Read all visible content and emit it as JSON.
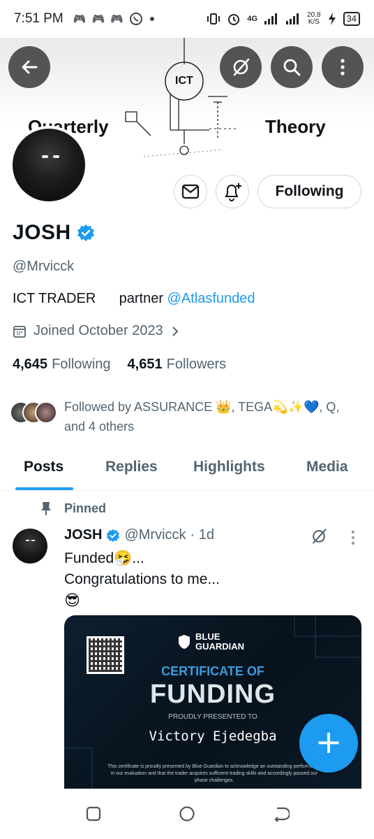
{
  "status_bar": {
    "time": "7:51 PM",
    "network": "4G",
    "speed_value": "20.8",
    "speed_unit": "K/S",
    "battery": "34"
  },
  "banner": {
    "logo_text": "ICT",
    "word_left": "Quarterly",
    "word_right": "Theory"
  },
  "profile": {
    "name": "JOSH",
    "handle": "@Mrvicck",
    "bio_text": "ICT TRADER      partner ",
    "bio_mention": "@Atlasfunded",
    "joined": "Joined October 2023",
    "following_count": "4,645",
    "following_label": "Following",
    "followers_count": "4,651",
    "followers_label": "Followers",
    "followed_by_line1": "Followed by ASSURANCE 👑, TEGA💫✨💙, Q,",
    "followed_by_line2": "and 4 others",
    "following_button": "Following"
  },
  "tabs": [
    "Posts",
    "Replies",
    "Highlights",
    "Media"
  ],
  "active_tab": "Posts",
  "pinned_tweet": {
    "pinned_label": "Pinned",
    "name": "JOSH",
    "handle": "@Mrvicck",
    "time": "· 1d",
    "line1": "Funded🤧...",
    "line2": "Congratulations to me...",
    "line3": "😎"
  },
  "certificate": {
    "brand_line1": "BLUE",
    "brand_line2": "GUARDIAN",
    "title_line1": "CERTIFICATE OF",
    "title_line2": "FUNDING",
    "presented": "PROUDLY PRESENTED TO",
    "recipient": "Victory Ejedegba",
    "fine_print": "This certificate is proudly presented by Blue Guardian to acknowledge an outstanding performance in our evaluation and that the trader acquires sufficient trading skills and accordingly passed our phase challenges."
  },
  "fab_label": "+",
  "colors": {
    "accent": "#1d9bf0",
    "text_primary": "#0f1419",
    "text_secondary": "#536471",
    "cert_background": "#06121c"
  }
}
